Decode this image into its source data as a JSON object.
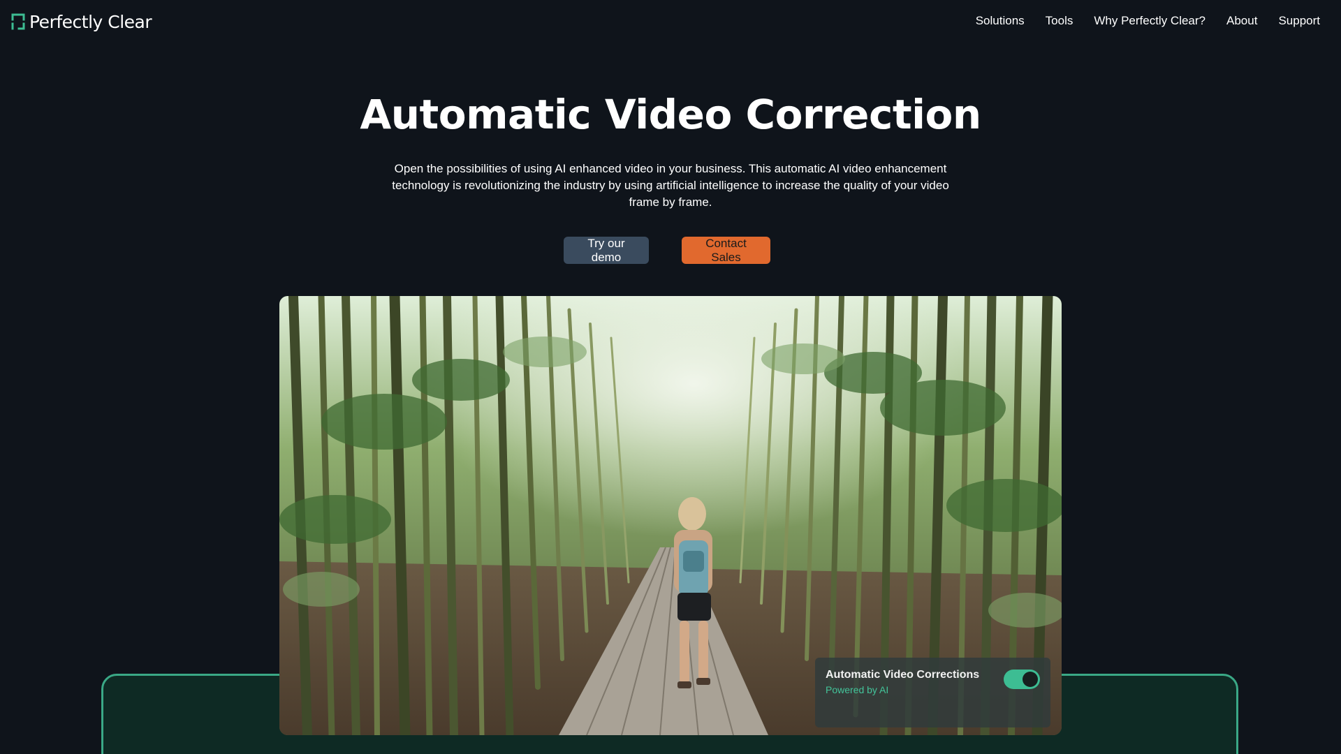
{
  "header": {
    "logo_text": "Perfectly Clear",
    "nav": [
      {
        "label": "Solutions"
      },
      {
        "label": "Tools"
      },
      {
        "label": "Why Perfectly Clear?"
      },
      {
        "label": "About"
      },
      {
        "label": "Support"
      }
    ]
  },
  "hero": {
    "title": "Automatic Video Correction",
    "description": "Open the possibilities of using AI enhanced video in your business. This automatic AI video enhancement technology is revolutionizing the industry by using artificial intelligence to increase the quality of your video frame by frame.",
    "buttons": {
      "demo_label": "Try our demo",
      "sales_label": "Contact Sales"
    }
  },
  "video": {
    "overlay": {
      "title": "Automatic Video Corrections",
      "subtitle": "Powered by AI",
      "toggle_on": true
    }
  },
  "colors": {
    "background": "#0f141b",
    "accent_green": "#3dbd93",
    "demo_button": "#3a4b5e",
    "sales_button": "#e1692e",
    "frame_border": "#3aa886"
  },
  "icons": {
    "logo": "perfectly-clear-bracket-icon"
  }
}
